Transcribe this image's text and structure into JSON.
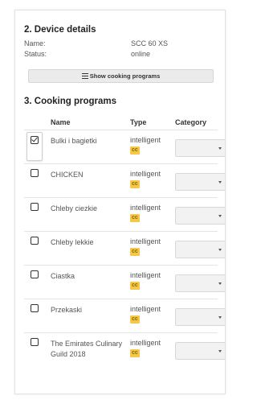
{
  "device_details": {
    "title": "2. Device details",
    "name_label": "Name:",
    "name_value": "SCC 60 XS",
    "status_label": "Status:",
    "status_value": "online",
    "show_programs_button": "Show cooking programs",
    "show_programs_icon": "list-icon"
  },
  "cooking_programs": {
    "title": "3. Cooking programs",
    "columns": {
      "name": "Name",
      "type": "Type",
      "category": "Category"
    },
    "rows": [
      {
        "name": "Bulki i bagietki",
        "type": "intelligent",
        "badge": "cc",
        "selected": true
      },
      {
        "name": "CHICKEN",
        "type": "intelligent",
        "badge": "cc",
        "selected": false
      },
      {
        "name": "Chleby ciezkie",
        "type": "intelligent",
        "badge": "cc",
        "selected": false
      },
      {
        "name": "Chleby lekkie",
        "type": "intelligent",
        "badge": "cc",
        "selected": false
      },
      {
        "name": "Ciastka",
        "type": "intelligent",
        "badge": "cc",
        "selected": false
      },
      {
        "name": "Przekaski",
        "type": "intelligent",
        "badge": "cc",
        "selected": false
      },
      {
        "name": "The Emirates Culinary Guild 2018",
        "type": "intelligent",
        "badge": "cc",
        "selected": false
      }
    ]
  },
  "colors": {
    "badge_bg": "#f5c84a",
    "button_bg": "#ebebeb"
  }
}
